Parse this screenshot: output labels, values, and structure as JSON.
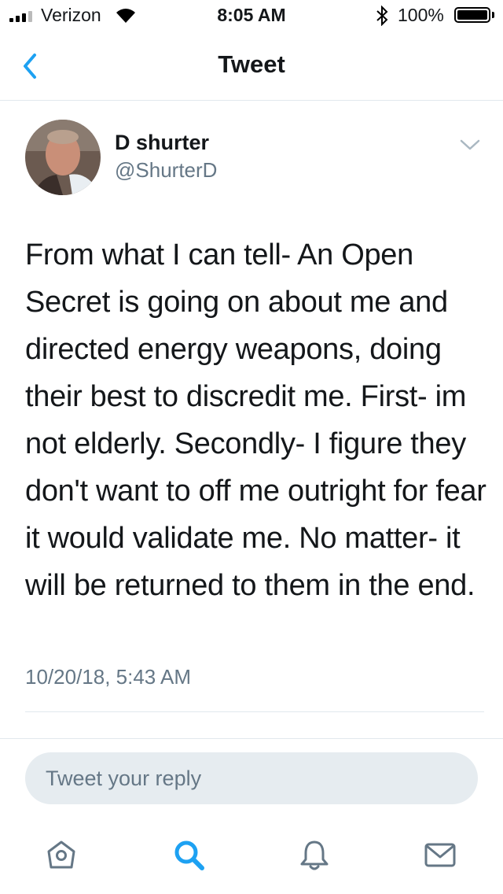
{
  "status_bar": {
    "carrier": "Verizon",
    "time": "8:05 AM",
    "battery_percent": "100%",
    "signal_bars": 3,
    "battery_level": 1.0,
    "icons": [
      "signal-icon",
      "wifi-icon",
      "bluetooth-icon",
      "battery-icon"
    ]
  },
  "nav": {
    "title": "Tweet",
    "back_icon": "chevron-left-icon"
  },
  "tweet": {
    "author_name": "D shurter",
    "author_handle": "@ShurterD",
    "text": "From what I can tell- An Open Secret is going on about me and directed energy weapons, doing their best to discredit me. First- im not elderly. Secondly- I figure they don't want to off me outright for fear it would validate me. No matter- it will be returned to them in the end.",
    "timestamp": "10/20/18, 5:43 AM",
    "menu_icon": "chevron-down-icon"
  },
  "reply": {
    "placeholder": "Tweet your reply"
  },
  "tab_bar": {
    "items": [
      "home-icon",
      "search-icon",
      "notifications-icon",
      "messages-icon"
    ],
    "active": "search-icon"
  },
  "colors": {
    "accent": "#1da1f2",
    "secondary_text": "#657786",
    "divider": "#e1e8ed",
    "reply_bg": "#e6ecf0"
  }
}
